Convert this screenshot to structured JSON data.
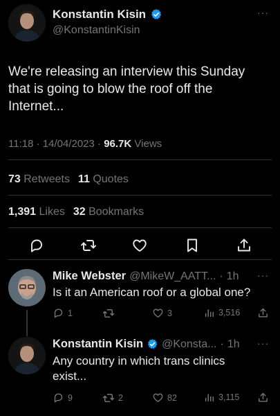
{
  "main_tweet": {
    "author_name": "Konstantin Kisin",
    "author_handle": "@KonstantinKisin",
    "more_label": "···",
    "text": "We're releasing an interview this Sunday\nthat is going to blow the roof off the\nInternet...",
    "time": "11:18",
    "sep": "·",
    "date": "14/04/2023",
    "views_count": "96.7K",
    "views_label": "Views",
    "retweets_count": "73",
    "retweets_label": "Retweets",
    "quotes_count": "11",
    "quotes_label": "Quotes",
    "likes_count": "1,391",
    "likes_label": "Likes",
    "bookmarks_count": "32",
    "bookmarks_label": "Bookmarks"
  },
  "replies": [
    {
      "author_name": "Mike Webster",
      "author_handle": "@MikeW_AATT...",
      "sep": "·",
      "time": "1h",
      "more_label": "···",
      "text": "Is it an American roof or a global one?",
      "reply_count": "1",
      "retweet_count": "",
      "like_count": "3",
      "view_count": "3,516"
    },
    {
      "author_name": "Konstantin Kisin",
      "author_handle": "@Konsta...",
      "sep": "·",
      "time": "1h",
      "more_label": "···",
      "text": "Any country in which trans clinics\nexist...",
      "reply_count": "9",
      "retweet_count": "2",
      "like_count": "82",
      "view_count": "3,115"
    }
  ],
  "colors": {
    "background": "#000000",
    "text": "#e7e9ea",
    "muted": "#71767b",
    "verified": "#1d9bf0",
    "divider": "#2f3336"
  },
  "icons": [
    "verified-badge-icon",
    "more-icon",
    "reply-icon",
    "retweet-icon",
    "like-icon",
    "bookmark-icon",
    "share-icon",
    "views-icon"
  ]
}
